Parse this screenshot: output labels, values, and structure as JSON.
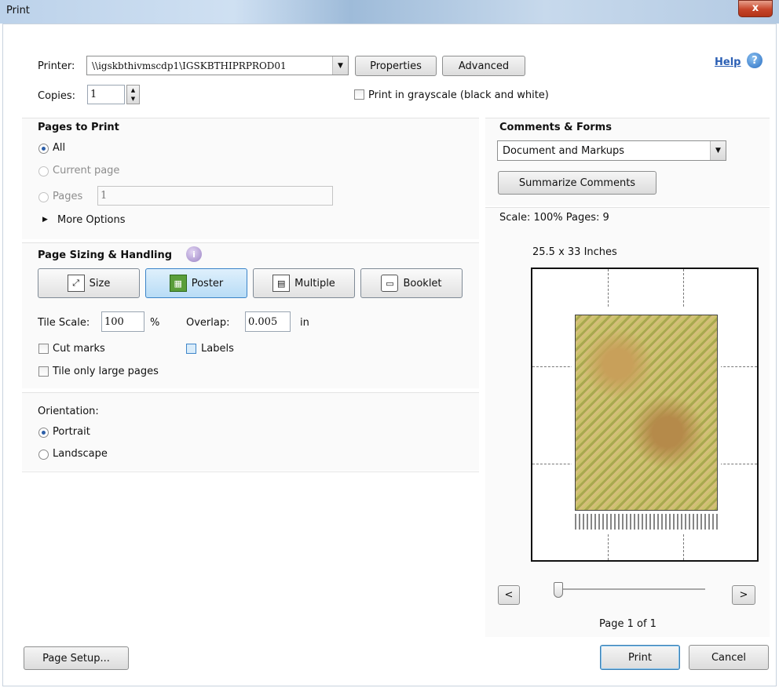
{
  "window": {
    "title": "Print",
    "close": "x"
  },
  "printer": {
    "label": "Printer:",
    "value": "\\\\igskbthivmscdp1\\IGSKBTHIPRPROD01",
    "properties": "Properties",
    "advanced": "Advanced",
    "help": "Help"
  },
  "copies": {
    "label": "Copies:",
    "value": "1"
  },
  "grayscale": {
    "label": "Print in grayscale (black and white)",
    "checked": false
  },
  "pages_to_print": {
    "title": "Pages to Print",
    "all": "All",
    "current": "Current page",
    "pages": "Pages",
    "pages_value": "1",
    "more": "More Options"
  },
  "sizing": {
    "title": "Page Sizing & Handling",
    "size": "Size",
    "poster": "Poster",
    "multiple": "Multiple",
    "booklet": "Booklet",
    "tile_scale_label": "Tile Scale:",
    "tile_scale_value": "100",
    "percent": "%",
    "overlap_label": "Overlap:",
    "overlap_value": "0.005",
    "overlap_unit": "in",
    "cut_marks": "Cut marks",
    "labels": "Labels",
    "tile_large": "Tile only large pages"
  },
  "orientation": {
    "title": "Orientation:",
    "portrait": "Portrait",
    "landscape": "Landscape"
  },
  "comments": {
    "title": "Comments & Forms",
    "value": "Document and Markups",
    "summarize": "Summarize Comments"
  },
  "preview": {
    "scale": "Scale: 100% Pages: 9",
    "dims": "25.5 x 33 Inches",
    "prev": "<",
    "next": ">",
    "page_of": "Page 1 of 1"
  },
  "footer": {
    "page_setup": "Page Setup...",
    "print": "Print",
    "cancel": "Cancel"
  }
}
